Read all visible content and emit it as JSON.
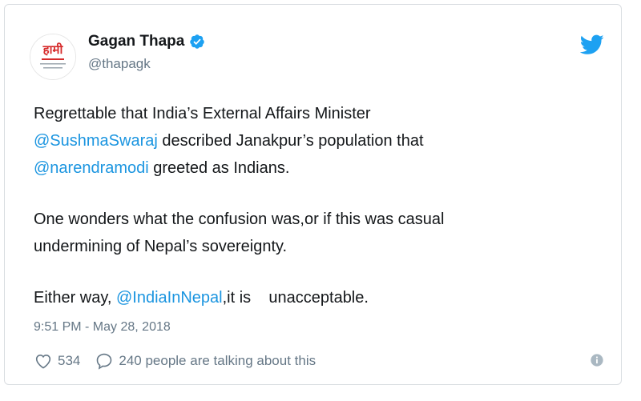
{
  "tweet": {
    "author_name": "Gagan Thapa",
    "author_handle": "@thapagk",
    "avatar_text": "हामी",
    "paragraphs": [
      [
        {
          "text": "Regrettable that India’s External Affairs Minister",
          "type": "text"
        },
        {
          "text": "\n",
          "type": "break"
        },
        {
          "text": "@SushmaSwaraj",
          "type": "mention"
        },
        {
          "text": " described Janakpur’s population that",
          "type": "text"
        },
        {
          "text": "\n",
          "type": "break"
        },
        {
          "text": "@narendramodi",
          "type": "mention"
        },
        {
          "text": " greeted as Indians.",
          "type": "text"
        }
      ],
      [
        {
          "text": "One wonders what the confusion was,or if this was casual",
          "type": "text"
        },
        {
          "text": "\n",
          "type": "break"
        },
        {
          "text": "undermining of Nepal’s sovereignty.",
          "type": "text"
        }
      ],
      [
        {
          "text": "Either way, ",
          "type": "text"
        },
        {
          "text": "@IndiaInNepal",
          "type": "mention"
        },
        {
          "text": ",it is    unacceptable.",
          "type": "text"
        }
      ]
    ],
    "timestamp": "9:51 PM - May 28, 2018",
    "like_count": "534",
    "conversation_text": "240 people are talking about this",
    "icons": {
      "verified": "verified-badge-icon",
      "brand": "twitter-bird-icon",
      "like": "heart-icon",
      "reply": "speech-bubble-icon",
      "info": "info-icon"
    },
    "colors": {
      "link": "#1b95e0",
      "muted": "#657786",
      "avatar_red": "#d62b2b"
    }
  }
}
